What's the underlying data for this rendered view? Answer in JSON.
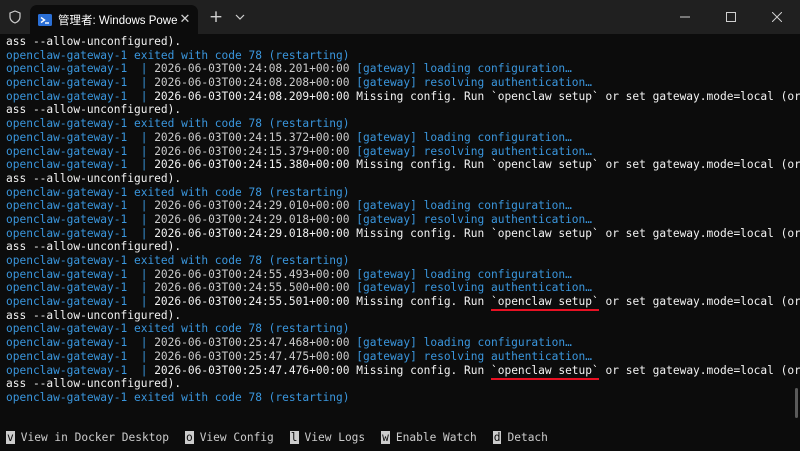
{
  "window": {
    "tab_title": "管理者: Windows PowerShell",
    "icons": [
      "shield-icon",
      "powershell-icon",
      "tab-close-icon",
      "new-tab-icon",
      "dropdown-icon",
      "minimize-icon",
      "maximize-icon",
      "close-icon"
    ]
  },
  "colors": {
    "background": "#0c0c0c",
    "titlebar": "#202020",
    "container_prefix": "#3a96dd",
    "log_text": "#cccccc",
    "highlight_underline": "#e81123"
  },
  "terminal": {
    "lines": [
      {
        "type": "cont",
        "text": "ass --allow-unconfigured)."
      },
      {
        "type": "exit",
        "text": "openclaw-gateway-1 exited with code 78 (restarting)"
      },
      {
        "type": "log",
        "prefix": "openclaw-gateway-1  | ",
        "timestamp": "2026-06-03T00:24:08.201+00:00",
        "message": "[gateway] loading configuration…",
        "bright": false
      },
      {
        "type": "log",
        "prefix": "openclaw-gateway-1  | ",
        "timestamp": "2026-06-03T00:24:08.208+00:00",
        "message": "[gateway] resolving authentication…",
        "bright": false
      },
      {
        "type": "log",
        "prefix": "openclaw-gateway-1  | ",
        "timestamp": "2026-06-03T00:24:08.209+00:00",
        "message": "Missing config. Run `openclaw setup` or set gateway.mode=local (or p",
        "bright": true
      },
      {
        "type": "cont",
        "text": "ass --allow-unconfigured)."
      },
      {
        "type": "exit",
        "text": "openclaw-gateway-1 exited with code 78 (restarting)"
      },
      {
        "type": "log",
        "prefix": "openclaw-gateway-1  | ",
        "timestamp": "2026-06-03T00:24:15.372+00:00",
        "message": "[gateway] loading configuration…",
        "bright": false
      },
      {
        "type": "log",
        "prefix": "openclaw-gateway-1  | ",
        "timestamp": "2026-06-03T00:24:15.379+00:00",
        "message": "[gateway] resolving authentication…",
        "bright": false
      },
      {
        "type": "log",
        "prefix": "openclaw-gateway-1  | ",
        "timestamp": "2026-06-03T00:24:15.380+00:00",
        "message": "Missing config. Run `openclaw setup` or set gateway.mode=local (or p",
        "bright": true
      },
      {
        "type": "cont",
        "text": "ass --allow-unconfigured)."
      },
      {
        "type": "exit",
        "text": "openclaw-gateway-1 exited with code 78 (restarting)"
      },
      {
        "type": "log",
        "prefix": "openclaw-gateway-1  | ",
        "timestamp": "2026-06-03T00:24:29.010+00:00",
        "message": "[gateway] loading configuration…",
        "bright": false
      },
      {
        "type": "log",
        "prefix": "openclaw-gateway-1  | ",
        "timestamp": "2026-06-03T00:24:29.018+00:00",
        "message": "[gateway] resolving authentication…",
        "bright": false
      },
      {
        "type": "log",
        "prefix": "openclaw-gateway-1  | ",
        "timestamp": "2026-06-03T00:24:29.018+00:00",
        "message": "Missing config. Run `openclaw setup` or set gateway.mode=local (or p",
        "bright": true
      },
      {
        "type": "cont",
        "text": "ass --allow-unconfigured)."
      },
      {
        "type": "exit",
        "text": "openclaw-gateway-1 exited with code 78 (restarting)"
      },
      {
        "type": "log",
        "prefix": "openclaw-gateway-1  | ",
        "timestamp": "2026-06-03T00:24:55.493+00:00",
        "message": "[gateway] loading configuration…",
        "bright": false
      },
      {
        "type": "log",
        "prefix": "openclaw-gateway-1  | ",
        "timestamp": "2026-06-03T00:24:55.500+00:00",
        "message": "[gateway] resolving authentication…",
        "bright": false
      },
      {
        "type": "log",
        "prefix": "openclaw-gateway-1  | ",
        "timestamp": "2026-06-03T00:24:55.501+00:00",
        "message": "Missing config. Run `openclaw setup` or set gateway.mode=local (or p",
        "bright": true,
        "underline": "`openclaw setup`"
      },
      {
        "type": "cont",
        "text": "ass --allow-unconfigured)."
      },
      {
        "type": "exit",
        "text": "openclaw-gateway-1 exited with code 78 (restarting)"
      },
      {
        "type": "log",
        "prefix": "openclaw-gateway-1  | ",
        "timestamp": "2026-06-03T00:25:47.468+00:00",
        "message": "[gateway] loading configuration…",
        "bright": false
      },
      {
        "type": "log",
        "prefix": "openclaw-gateway-1  | ",
        "timestamp": "2026-06-03T00:25:47.475+00:00",
        "message": "[gateway] resolving authentication…",
        "bright": false
      },
      {
        "type": "log",
        "prefix": "openclaw-gateway-1  | ",
        "timestamp": "2026-06-03T00:25:47.476+00:00",
        "message": "Missing config. Run `openclaw setup` or set gateway.mode=local (or p",
        "bright": true,
        "underline": "`openclaw setup`"
      },
      {
        "type": "cont",
        "text": "ass --allow-unconfigured)."
      },
      {
        "type": "exit",
        "text": "openclaw-gateway-1 exited with code 78 (restarting)"
      }
    ]
  },
  "footer": {
    "items": [
      {
        "key": "v",
        "label": "View in Docker Desktop"
      },
      {
        "key": "o",
        "label": "View Config"
      },
      {
        "key": "l",
        "label": "View Logs"
      },
      {
        "key": "w",
        "label": "Enable Watch"
      },
      {
        "key": "d",
        "label": "Detach"
      }
    ]
  }
}
